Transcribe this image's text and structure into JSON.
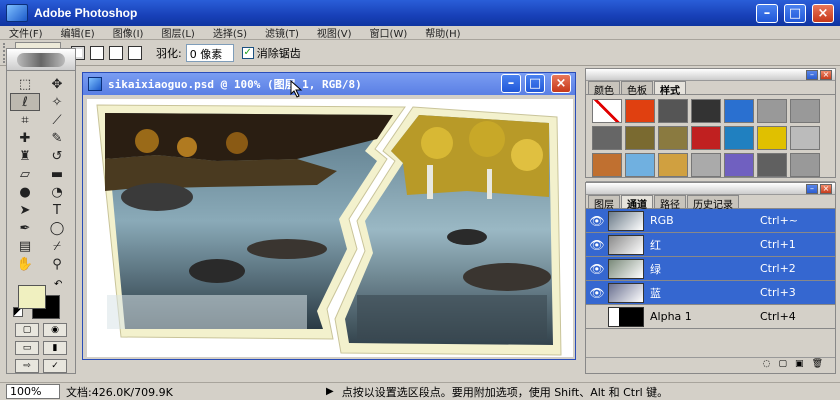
{
  "app": {
    "title": "Adobe Photoshop"
  },
  "menu": [
    "文件(F)",
    "编辑(E)",
    "图像(I)",
    "图层(L)",
    "选择(S)",
    "滤镜(T)",
    "视图(V)",
    "窗口(W)",
    "帮助(H)"
  ],
  "options": {
    "feather_label": "羽化:",
    "feather_value": "0 像素",
    "antialias_label": "消除锯齿",
    "antialias_checked": "✓"
  },
  "document": {
    "title": "sikaixiaoguo.psd @ 100% (图层 1, RGB/8)"
  },
  "status": {
    "zoom": "100%",
    "doc_info": "文档:426.0K/709.9K",
    "hint": "点按以设置选区段点。要用附加选项，使用 Shift、Alt 和 Ctrl 键。"
  },
  "panels": {
    "styles_tabs": [
      "颜色",
      "色板",
      "样式"
    ],
    "layers_tabs": [
      "图层",
      "通道",
      "路径",
      "历史记录"
    ]
  },
  "channels": [
    {
      "name": "RGB",
      "shortcut": "Ctrl+~",
      "selected": true
    },
    {
      "name": "红",
      "shortcut": "Ctrl+1",
      "selected": true
    },
    {
      "name": "绿",
      "shortcut": "Ctrl+2",
      "selected": true
    },
    {
      "name": "蓝",
      "shortcut": "Ctrl+3",
      "selected": true
    },
    {
      "name": "Alpha 1",
      "shortcut": "Ctrl+4",
      "selected": false
    }
  ],
  "style_colors": [
    "#ffffff",
    "#e04010",
    "#555555",
    "#333333",
    "#2a70d0",
    "#999999",
    "#999999",
    "#666666",
    "#7a6a30",
    "#8a7a40",
    "#c02020",
    "#2080c0",
    "#e0c000",
    "#bbbbbb",
    "#c07030",
    "#70b0e0",
    "#d0a040",
    "#aaaaaa",
    "#7060c0",
    "#606060",
    "#999999"
  ]
}
